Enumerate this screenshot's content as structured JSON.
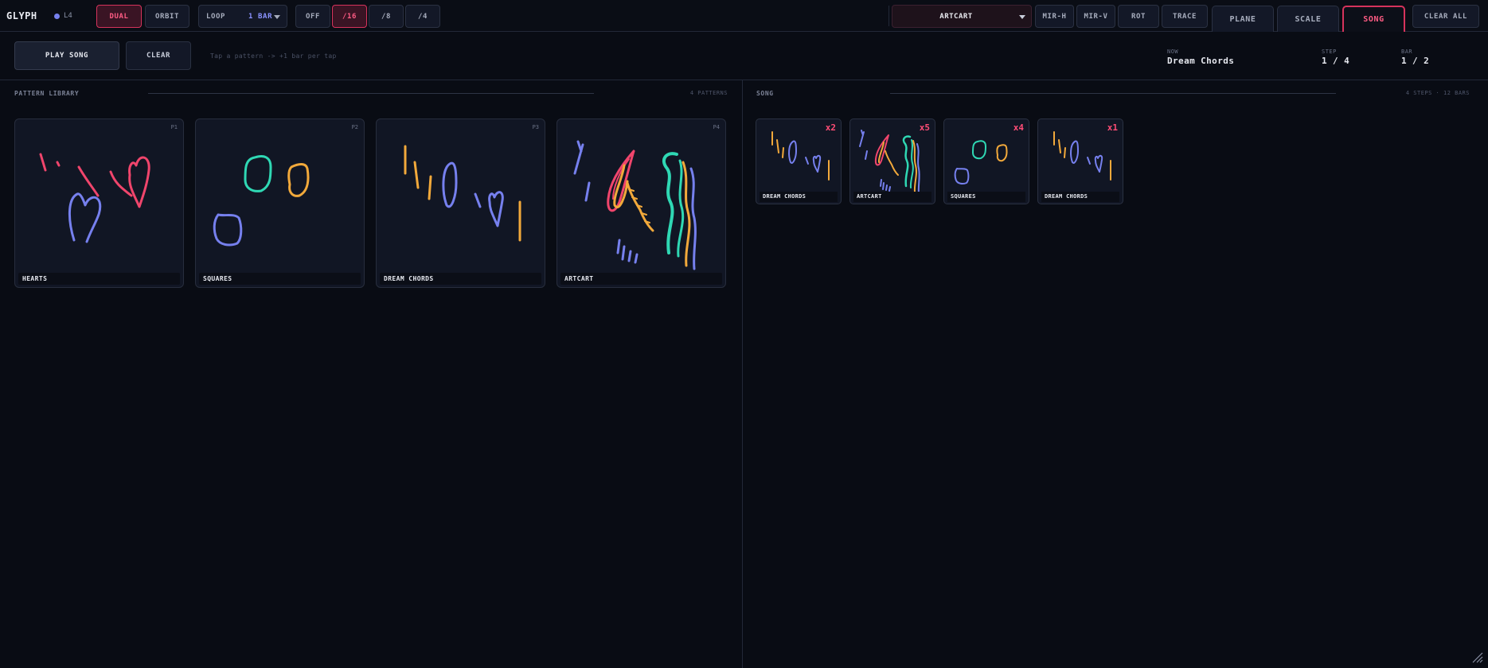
{
  "app": {
    "title": "GLYPH",
    "layer": "L4"
  },
  "toolbar": {
    "dual": "DUAL",
    "orbit": "ORBIT",
    "loop_label": "LOOP",
    "loop_value": "1 BAR",
    "quant": [
      "OFF",
      "/16",
      "/8",
      "/4"
    ],
    "quant_selected": "/16",
    "pattern_select": "ARTCART",
    "mir_h": "MIR-H",
    "mir_v": "MIR-V",
    "rot": "ROT",
    "trace": "TRACE",
    "tabs": [
      "PLANE",
      "SCALE",
      "SONG"
    ],
    "tab_selected": "SONG",
    "clear_all": "CLEAR ALL"
  },
  "transport": {
    "play_song": "PLAY SONG",
    "clear": "CLEAR",
    "hint": "Tap a pattern  ->  +1 bar per tap",
    "now_label": "NOW",
    "now_value": "Dream Chords",
    "step_label": "STEP",
    "step_value": "1 / 4",
    "bar_label": "BAR",
    "bar_value": "1 / 2"
  },
  "library": {
    "title": "PATTERN LIBRARY",
    "count": "4 PATTERNS",
    "patterns": [
      {
        "id": "P1",
        "name": "HEARTS"
      },
      {
        "id": "P2",
        "name": "SQUARES"
      },
      {
        "id": "P3",
        "name": "DREAM CHORDS"
      },
      {
        "id": "P4",
        "name": "ARTCART"
      }
    ]
  },
  "song": {
    "title": "SONG",
    "count": "4 STEPS  ·  12 BARS",
    "steps": [
      {
        "mult": "x2",
        "name": "DREAM CHORDS"
      },
      {
        "mult": "x5",
        "name": "ARTCART"
      },
      {
        "mult": "x4",
        "name": "SQUARES"
      },
      {
        "mult": "x1",
        "name": "DREAM CHORDS"
      }
    ]
  },
  "colors": {
    "accent": "#ff4d76",
    "violet": "#7680ee",
    "teal": "#2fd8b4",
    "amber": "#f2a93b",
    "rose": "#f0456c"
  }
}
